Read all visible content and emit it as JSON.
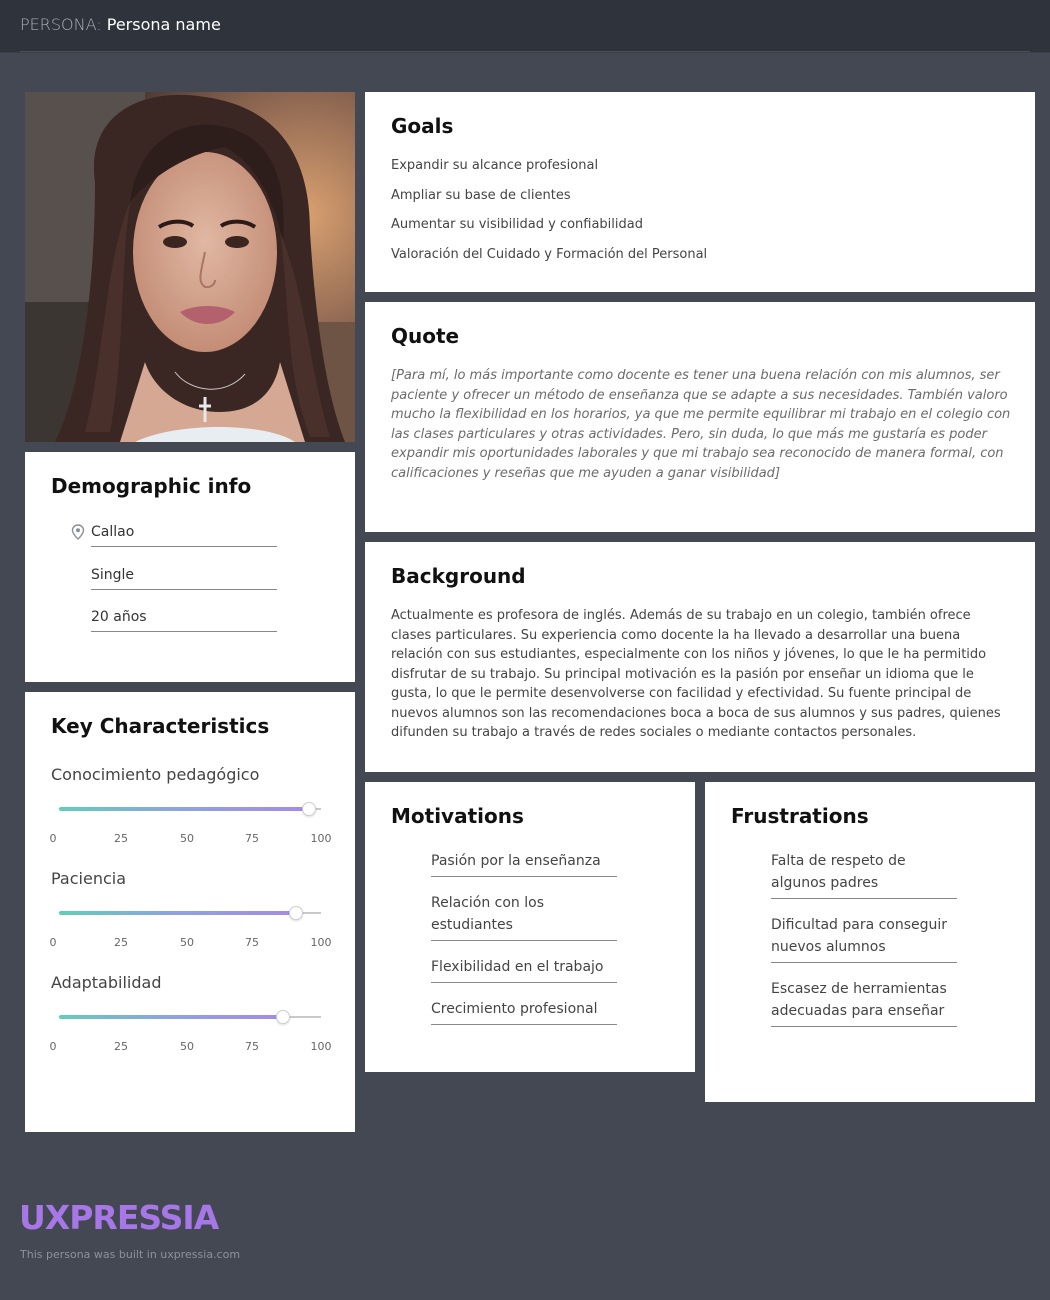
{
  "header": {
    "prefix": "PERSONA:",
    "name": "Persona name"
  },
  "photo": {
    "alt": "Persona photo"
  },
  "goals": {
    "title": "Goals",
    "items": [
      "Expandir su alcance profesional",
      "Ampliar su base de clientes",
      "Aumentar su visibilidad y confiabilidad",
      "Valoración del Cuidado y Formación del Personal"
    ]
  },
  "quote": {
    "title": "Quote",
    "text": "[Para mí, lo más importante como docente es tener una buena relación con mis alumnos, ser paciente y ofrecer un método de enseñanza que se adapte a sus necesidades. También valoro mucho la flexibilidad en los horarios, ya que me permite equilibrar mi trabajo en el colegio con las clases particulares y otras actividades. Pero, sin duda, lo que más me gustaría es poder expandir mis oportunidades laborales y que mi trabajo sea reconocido de manera formal, con calificaciones y reseñas que me ayuden a ganar visibilidad]"
  },
  "background": {
    "title": "Background",
    "text": "Actualmente es profesora de inglés. Además de su trabajo en un colegio, también ofrece clases particulares. Su experiencia como docente la ha llevado a desarrollar una buena relación con sus estudiantes, especialmente con los niños y jóvenes, lo que le ha permitido disfrutar de su trabajo. Su principal motivación es la pasión por enseñar un idioma que le gusta, lo que le permite desenvolverse con facilidad y efectividad. Su fuente principal de nuevos alumnos son las recomendaciones boca a boca de sus alumnos y sus padres, quienes difunden su trabajo a través de redes sociales o mediante contactos personales."
  },
  "demographic": {
    "title": "Demographic info",
    "location": "Callao",
    "status": "Single",
    "age": "20 años",
    "location_icon": "map-pin-icon"
  },
  "key_characteristics": {
    "title": "Key Characteristics",
    "scale_ticks": [
      "0",
      "25",
      "50",
      "75",
      "100"
    ],
    "items": [
      {
        "label": "Conocimiento pedagógico",
        "value": 95
      },
      {
        "label": "Paciencia",
        "value": 90
      },
      {
        "label": "Adaptabilidad",
        "value": 85
      }
    ],
    "gradient_colors": [
      "#63cdb8",
      "#a58ae8"
    ]
  },
  "motivations": {
    "title": "Motivations",
    "items": [
      "Pasión por la enseñanza",
      "Relación con los estudiantes",
      "Flexibilidad en el trabajo",
      "Crecimiento profesional"
    ]
  },
  "frustrations": {
    "title": "Frustrations",
    "items": [
      "Falta de respeto de algunos padres",
      "Dificultad para conseguir nuevos alumnos",
      "Escasez de herramientas adecuadas para enseñar"
    ]
  },
  "footer": {
    "logo": "UXPRESSIA",
    "note": "This persona was built in uxpressia.com",
    "logo_color": "#a777e8"
  }
}
